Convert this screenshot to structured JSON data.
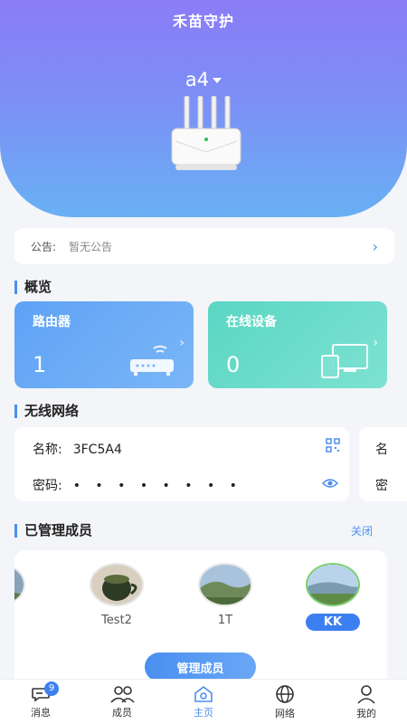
{
  "header": {
    "app_title": "禾苗守护",
    "device_name": "a4"
  },
  "notice": {
    "label": "公告:",
    "text": "暂无公告"
  },
  "overview": {
    "title": "概览",
    "router": {
      "label": "路由器",
      "count": "1"
    },
    "online": {
      "label": "在线设备",
      "count": "0"
    }
  },
  "wifi": {
    "title": "无线网络",
    "name_label": "名称:",
    "name_value": "3FC5A4",
    "password_label": "密码:",
    "password_value": "• • • • • • • •",
    "peek_name_label": "名",
    "peek_password_label": "密"
  },
  "members": {
    "title": "已管理成员",
    "close_label": "关闭",
    "items": [
      {
        "name": "Test2"
      },
      {
        "name": "1T"
      },
      {
        "name": "KK"
      }
    ],
    "manage_button": "管理成员"
  },
  "tabbar": {
    "messages": "消息",
    "messages_badge": "9",
    "members": "成员",
    "home": "主页",
    "network": "网络",
    "mine": "我的"
  },
  "colors": {
    "accent": "#4a8ff0",
    "hero_top": "#8a7cf6",
    "hero_bottom": "#68b0f4",
    "online_card": "#5ad6c4"
  }
}
